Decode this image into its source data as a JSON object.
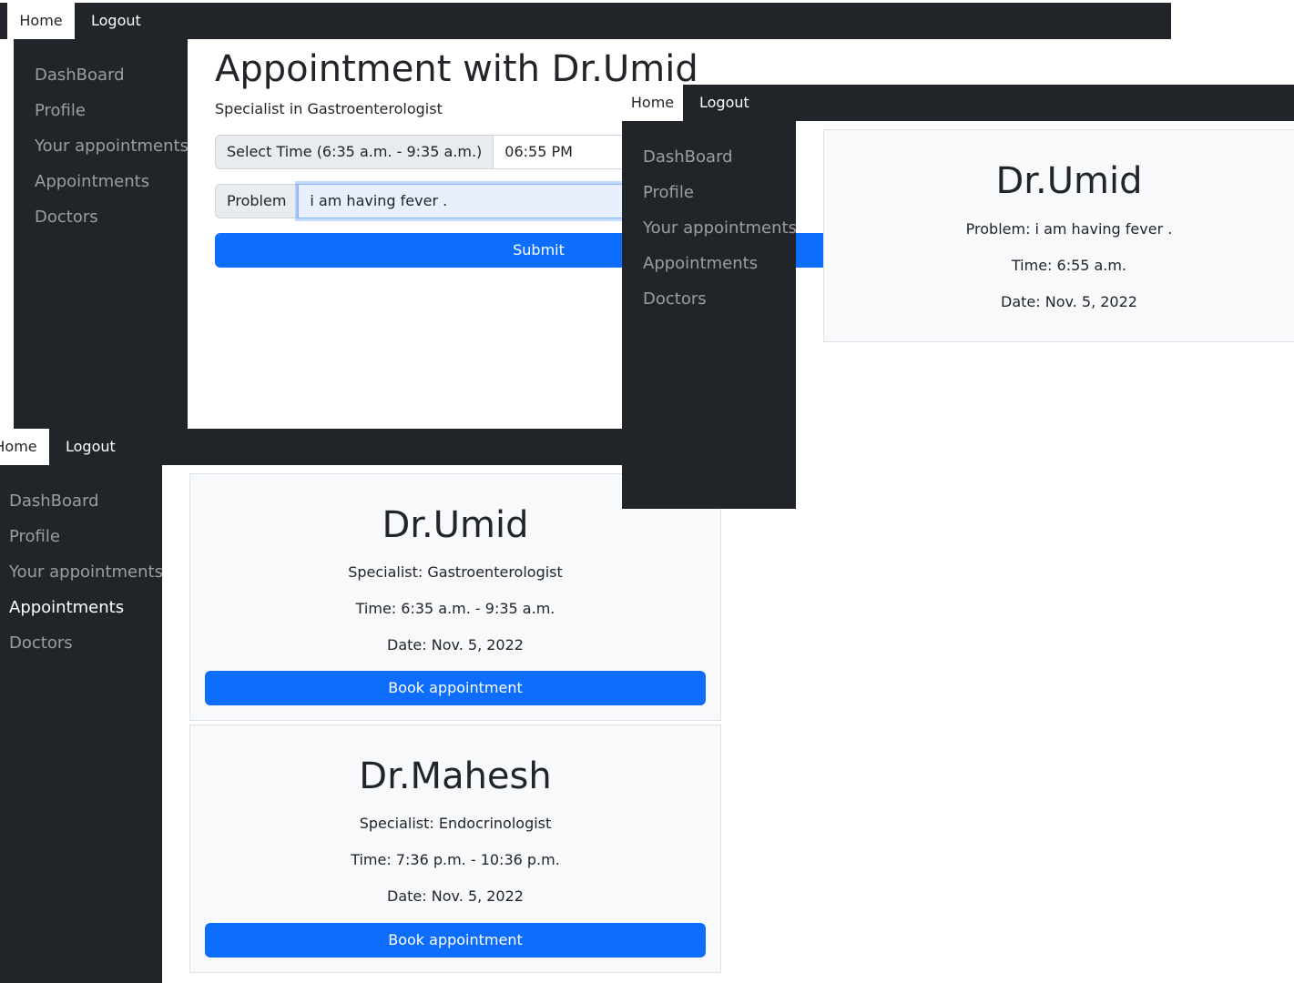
{
  "nav": {
    "home_label": "Home",
    "logout_label": "Logout"
  },
  "sidebar": {
    "items": [
      {
        "label": "DashBoard"
      },
      {
        "label": "Profile"
      },
      {
        "label": "Your appointments"
      },
      {
        "label": "Appointments"
      },
      {
        "label": "Doctors"
      }
    ]
  },
  "booking_form": {
    "title": "Appointment with Dr.Umid",
    "subtitle": "Specialist in Gastroenterologist",
    "time_label": "Select Time (6:35 a.m. - 9:35 a.m.)",
    "time_value": "06:55 PM",
    "problem_label": "Problem",
    "problem_value": "i am having fever .",
    "submit_label": "Submit"
  },
  "your_appointment": {
    "doctor": "Dr.Umid",
    "problem": "Problem: i am having fever .",
    "time": "Time: 6:55 a.m.",
    "date": "Date: Nov. 5, 2022"
  },
  "doctors": [
    {
      "name": "Dr.Umid",
      "specialist": "Specialist: Gastroenterologist",
      "time": "Time: 6:35 a.m. - 9:35 a.m.",
      "date": "Date: Nov. 5, 2022",
      "button": "Book appointment"
    },
    {
      "name": "Dr.Mahesh",
      "specialist": "Specialist: Endocrinologist",
      "time": "Time: 7:36 p.m. - 10:36 p.m.",
      "date": "Date: Nov. 5, 2022",
      "button": "Book appointment"
    }
  ],
  "colors": {
    "dark": "#212529",
    "primary": "#0d6efd",
    "card_bg": "#f8f9fa",
    "sidebar_text": "#8c8e91"
  }
}
